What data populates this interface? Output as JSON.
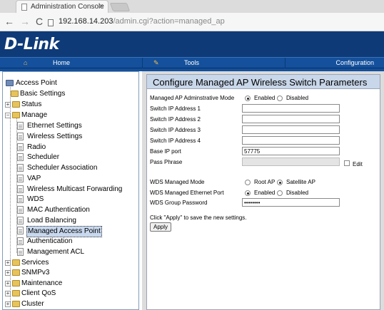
{
  "browser": {
    "tab_title": "Administration Console",
    "tab_close": "×",
    "nav_back": "←",
    "nav_forward": "→",
    "nav_reload": "C",
    "url_host": "192.168.14.203",
    "url_path": "/admin.cgi?action=managed_ap"
  },
  "header": {
    "logo": "D-Link",
    "menu": {
      "home": "Home",
      "tools": "Tools",
      "configuration": "Configuration"
    },
    "icons": {
      "home": "home-icon",
      "tools": "tools-icon"
    }
  },
  "tree": {
    "root": "Access Point",
    "basic_settings": "Basic Settings",
    "status": "Status",
    "manage": "Manage",
    "children": [
      "Ethernet Settings",
      "Wireless Settings",
      "Radio",
      "Scheduler",
      "Scheduler Association",
      "VAP",
      "Wireless Multicast Forwarding",
      "WDS",
      "MAC Authentication",
      "Load Balancing",
      "Managed Access Point",
      "Authentication",
      "Management ACL"
    ],
    "selected": "Managed Access Point",
    "bottom": [
      "Services",
      "SNMPv3",
      "Maintenance",
      "Client QoS",
      "Cluster"
    ],
    "plus": "+",
    "minus": "−"
  },
  "form": {
    "title": "Configure Managed AP Wireless Switch Parameters",
    "admin_mode": {
      "label": "Managed AP Adminstrative Mode",
      "enabled": "Enabled",
      "disabled": "Disabled",
      "selected": "Enabled"
    },
    "switch_ips": [
      {
        "label": "Switch IP Address 1",
        "value": ""
      },
      {
        "label": "Switch IP Address 2",
        "value": ""
      },
      {
        "label": "Switch IP Address 3",
        "value": ""
      },
      {
        "label": "Switch IP Address 4",
        "value": ""
      }
    ],
    "base_ip_port": {
      "label": "Base IP port",
      "value": "57775"
    },
    "pass_phrase": {
      "label": "Pass Phrase",
      "value": "",
      "edit": "Edit"
    },
    "wds_managed_mode": {
      "label": "WDS Managed Mode",
      "root": "Root AP",
      "satellite": "Satellite AP",
      "selected": "Satellite AP"
    },
    "wds_eth_port": {
      "label": "WDS Managed Ethernet Port",
      "enabled": "Enabled",
      "disabled": "Disabled",
      "selected": "Enabled"
    },
    "wds_group_password": {
      "label": "WDS Group Password",
      "value": "••••••••"
    },
    "note": "Click \"Apply\" to save the new settings.",
    "apply": "Apply"
  }
}
